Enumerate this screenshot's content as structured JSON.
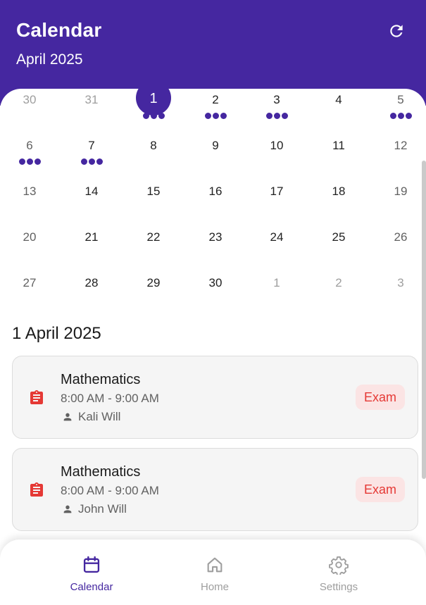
{
  "header": {
    "title": "Calendar",
    "subtitle": "April 2025"
  },
  "calendar": {
    "rows": [
      [
        {
          "day": "30",
          "other": true,
          "dots": 0
        },
        {
          "day": "31",
          "other": true,
          "dots": 0
        },
        {
          "day": "1",
          "today": true,
          "dots": 3
        },
        {
          "day": "2",
          "dots": 3
        },
        {
          "day": "3",
          "dots": 3
        },
        {
          "day": "4",
          "dots": 0
        },
        {
          "day": "5",
          "weekend": true,
          "dots": 3
        }
      ],
      [
        {
          "day": "6",
          "weekend": true,
          "dots": 3
        },
        {
          "day": "7",
          "dots": 3
        },
        {
          "day": "8",
          "dots": 0
        },
        {
          "day": "9",
          "dots": 0
        },
        {
          "day": "10",
          "dots": 0
        },
        {
          "day": "11",
          "dots": 0
        },
        {
          "day": "12",
          "weekend": true,
          "dots": 0
        }
      ],
      [
        {
          "day": "13",
          "weekend": true,
          "dots": 0
        },
        {
          "day": "14",
          "dots": 0
        },
        {
          "day": "15",
          "dots": 0
        },
        {
          "day": "16",
          "dots": 0
        },
        {
          "day": "17",
          "dots": 0
        },
        {
          "day": "18",
          "dots": 0
        },
        {
          "day": "19",
          "weekend": true,
          "dots": 0
        }
      ],
      [
        {
          "day": "20",
          "weekend": true,
          "dots": 0
        },
        {
          "day": "21",
          "dots": 0
        },
        {
          "day": "22",
          "dots": 0
        },
        {
          "day": "23",
          "dots": 0
        },
        {
          "day": "24",
          "dots": 0
        },
        {
          "day": "25",
          "dots": 0
        },
        {
          "day": "26",
          "weekend": true,
          "dots": 0
        }
      ],
      [
        {
          "day": "27",
          "weekend": true,
          "dots": 0
        },
        {
          "day": "28",
          "dots": 0
        },
        {
          "day": "29",
          "dots": 0
        },
        {
          "day": "30",
          "dots": 0
        },
        {
          "day": "1",
          "other": true,
          "dots": 0
        },
        {
          "day": "2",
          "other": true,
          "dots": 0
        },
        {
          "day": "3",
          "other": true,
          "dots": 0
        }
      ]
    ]
  },
  "selected_day": {
    "heading": "1 April 2025"
  },
  "events": [
    {
      "subject": "Mathematics",
      "time": "8:00 AM - 9:00 AM",
      "teacher": "Kali Will",
      "badge": "Exam",
      "icon": "assignment-icon"
    },
    {
      "subject": "Mathematics",
      "time": "8:00 AM - 9:00 AM",
      "teacher": "John Will",
      "badge": "Exam",
      "icon": "assignment-icon"
    }
  ],
  "nav": {
    "calendar_label": "Calendar",
    "home_label": "Home",
    "settings_label": "Settings",
    "active": "calendar"
  },
  "colors": {
    "primary": "#4527a0",
    "exam_text": "#e53935",
    "exam_bg": "#fbe4e4"
  }
}
